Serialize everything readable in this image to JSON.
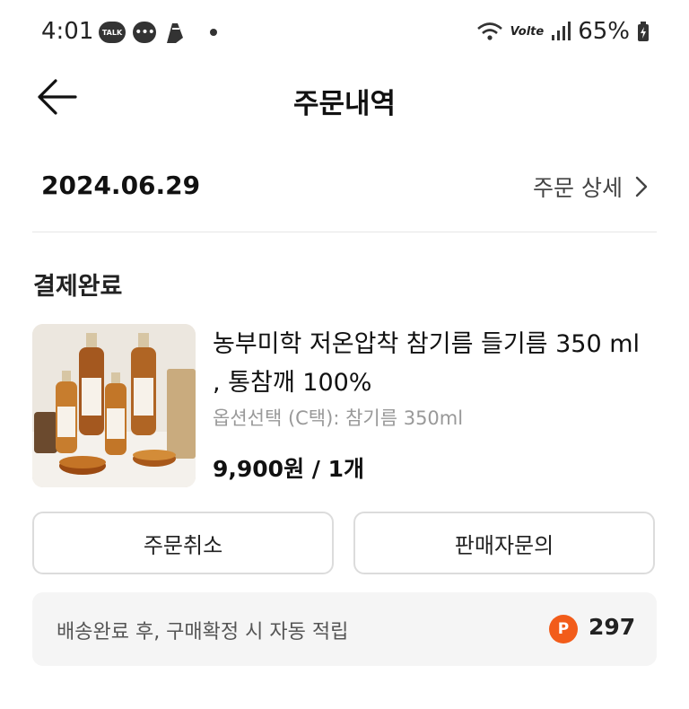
{
  "status_bar": {
    "time": "4:01",
    "talk_label": "TALK",
    "volte_label": "Volte",
    "battery": "65%"
  },
  "header": {
    "title": "주문내역"
  },
  "order": {
    "date": "2024.06.29",
    "detail_link": "주문 상세",
    "status": "결제완료"
  },
  "product": {
    "name": "농부미학 저온압착 참기름 들기름 350 ml , 통참깨 100%",
    "option": "옵션선택 (C택): 참기름 350ml",
    "price": "9,900원 / 1개"
  },
  "actions": {
    "cancel_label": "주문취소",
    "inquiry_label": "판매자문의"
  },
  "points": {
    "text": "배송완료 후, 구매확정 시 자동 적립",
    "badge": "P",
    "value": "297"
  },
  "colors": {
    "points_badge": "#f25c1a",
    "divider": "#e6e6e6",
    "points_bg": "#f5f5f5"
  }
}
